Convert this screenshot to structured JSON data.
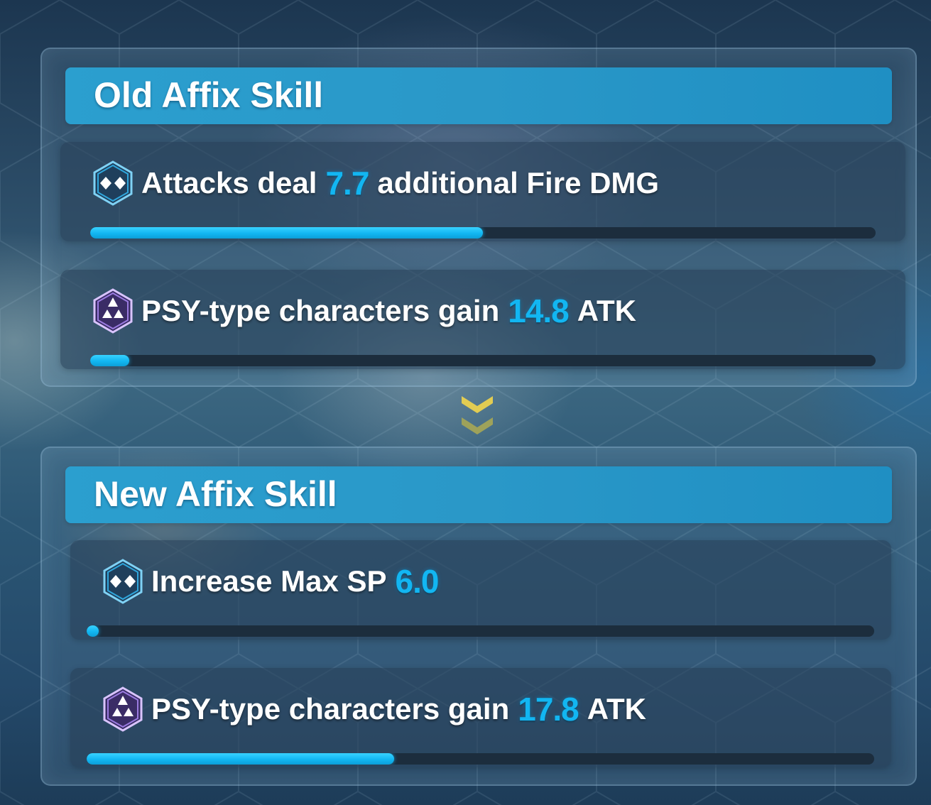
{
  "old_affix": {
    "title": "Old Affix Skill",
    "skills": [
      {
        "icon": "blue-diamond-icon",
        "prefix": "Attacks deal",
        "value": "7.7",
        "suffix": "additional Fire DMG",
        "progress": 0.5
      },
      {
        "icon": "psy-triangle-icon",
        "prefix": "PSY-type characters gain",
        "value": "14.8",
        "suffix": "ATK",
        "progress": 0.05
      }
    ]
  },
  "arrow": {
    "icon": "double-chevron-down-icon"
  },
  "new_affix": {
    "title": "New Affix Skill",
    "skills": [
      {
        "icon": "blue-diamond-icon",
        "prefix": "Increase Max SP",
        "value": "6.0",
        "suffix": "",
        "progress": 0.015
      },
      {
        "icon": "psy-triangle-icon",
        "prefix": "PSY-type characters gain",
        "value": "17.8",
        "suffix": "ATK",
        "progress": 0.39
      }
    ]
  },
  "colors": {
    "header": "#2a98c8",
    "value": "#12b6f2",
    "bar_fill": "#12b6f2",
    "bar_track": "#1c2d3d",
    "arrow": "#e2cc52"
  }
}
